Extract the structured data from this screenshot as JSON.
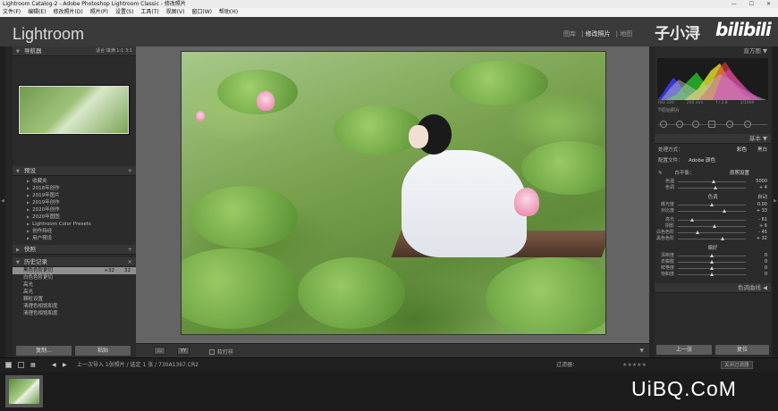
{
  "window": {
    "title": "Lightroom Catalog-2 - Adobe Photoshop Lightroom Classic - 修改照片",
    "controls": "— ☐ ✕"
  },
  "menu": [
    "文件(F)",
    "编辑(E)",
    "修改照片(D)",
    "照片(P)",
    "设置(S)",
    "工具(T)",
    "视图(V)",
    "窗口(W)",
    "帮助(H)"
  ],
  "app": {
    "logo": "Lightroom"
  },
  "modules": {
    "library": "图库",
    "develop": "修改照片",
    "map": "地图"
  },
  "watermark": {
    "text1": "子小浔",
    "text2": "bilibili"
  },
  "left": {
    "navigator": {
      "title": "导航器",
      "zoom": "适合  填满  1:1  3:1"
    },
    "presets": {
      "title": "预设",
      "add": "+",
      "items": [
        "收藏夹",
        "2018年创作",
        "2019年图片",
        "2019年创作",
        "2020年创作",
        "2020年图图",
        "Lightroom Color Presets",
        "创作持经",
        "用户预设"
      ]
    },
    "snapshots": {
      "title": "快照",
      "add": "+"
    },
    "history": {
      "title": "历史记录",
      "close": "×",
      "items": [
        {
          "label": "黑色色阶更切",
          "v1": "+32",
          "v2": "32"
        },
        {
          "label": "白色色阶更切",
          "v1": "",
          "v2": ""
        },
        {
          "label": "高光",
          "v1": "",
          "v2": ""
        },
        {
          "label": "高光",
          "v1": "",
          "v2": ""
        },
        {
          "label": "颗粒设置",
          "v1": "",
          "v2": ""
        },
        {
          "label": "清理色相饱和度",
          "v1": "",
          "v2": ""
        },
        {
          "label": "清理色相饱和度",
          "v1": "",
          "v2": ""
        }
      ]
    },
    "copy_btn": "复制...",
    "paste_btn": "粘贴"
  },
  "center": {
    "soft_proof": "软打样"
  },
  "right": {
    "histogram": {
      "title": "直方图",
      "info": [
        "ISO 320",
        "200 mm",
        "f / 2.8",
        "1/1000 秒"
      ],
      "original": "原始照片"
    },
    "basic": {
      "title": "基本",
      "treatment": {
        "label": "处理方式：",
        "color": "彩色",
        "bw": "黑白"
      },
      "profile": {
        "label": "配置文件：",
        "value": "Adobe 颜色"
      },
      "wb": {
        "label": "白平衡：",
        "value": "原照设置"
      },
      "sliders1": [
        {
          "label": "色温",
          "value": "5000"
        },
        {
          "label": "色调",
          "value": "+ 4"
        }
      ],
      "tone": {
        "label": "色调",
        "auto": "自动"
      },
      "sliders2": [
        {
          "label": "曝光度",
          "value": "0.00"
        },
        {
          "label": "对比度",
          "value": "+ 33"
        },
        {
          "label": "高光",
          "value": "- 61"
        },
        {
          "label": "阴影",
          "value": "+ 6"
        },
        {
          "label": "白色色阶",
          "value": "- 45"
        },
        {
          "label": "黑色色阶",
          "value": "+ 32"
        }
      ],
      "presence": {
        "label": "偏好"
      },
      "sliders3": [
        {
          "label": "清晰度",
          "value": "0"
        },
        {
          "label": "去朦胧",
          "value": "0"
        },
        {
          "label": "鲜艳度",
          "value": "0"
        },
        {
          "label": "饱和度",
          "value": "0"
        }
      ]
    },
    "tone_curve": "色调曲线",
    "prev_btn": "上一张",
    "reset_btn": "复位"
  },
  "filmbar": {
    "source": "上一次导入   1张照片 / 选定 1 张 / 730A1367.CR2",
    "filter_label": "过滤器：",
    "stars": "★★★★★",
    "filter_off": "关闭过滤器"
  },
  "site_watermark": "UiBQ.CoM"
}
